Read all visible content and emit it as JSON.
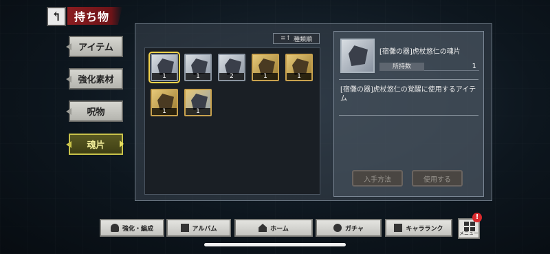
{
  "header": {
    "title": "持ち物",
    "back_icon": "↰"
  },
  "categories": [
    {
      "label": "アイテム",
      "active": false
    },
    {
      "label": "強化素材",
      "active": false
    },
    {
      "label": "呪物",
      "active": false
    },
    {
      "label": "魂片",
      "active": true
    }
  ],
  "sort": {
    "label": "種類順",
    "icon": "≡↑"
  },
  "items": [
    {
      "count": "1",
      "frame": "silver",
      "selected": true
    },
    {
      "count": "1",
      "frame": "silver",
      "selected": false
    },
    {
      "count": "2",
      "frame": "silver",
      "selected": false
    },
    {
      "count": "1",
      "frame": "gold",
      "selected": false
    },
    {
      "count": "1",
      "frame": "gold",
      "selected": false
    },
    {
      "count": "1",
      "frame": "gold",
      "selected": false
    },
    {
      "count": "1",
      "frame": "silver",
      "selected": false
    }
  ],
  "detail": {
    "name": "[宿儺の器]虎杖悠仁の魂片",
    "owned_label": "所持数",
    "owned_value": "1",
    "description": "[宿儺の器]虎杖悠仁の覚醒に使用するアイテム",
    "obtain_button": "入手方法",
    "use_button": "使用する"
  },
  "bottom_nav": [
    {
      "label": "強化・編成",
      "icon": "team-icon"
    },
    {
      "label": "アルバム",
      "icon": "album-icon"
    },
    {
      "label": "ホーム",
      "icon": "home-icon"
    },
    {
      "label": "ガチャ",
      "icon": "gacha-icon"
    },
    {
      "label": "キャラランク",
      "icon": "rank-icon"
    }
  ],
  "menu": {
    "label": "メニュー",
    "badge": "!"
  }
}
